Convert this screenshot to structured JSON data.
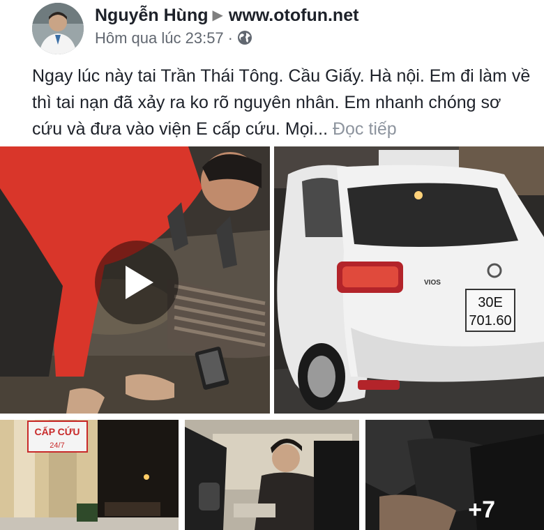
{
  "post": {
    "author": "Nguyễn Hùng",
    "group": "www.otofun.net",
    "timestamp": "Hôm qua lúc 23:57",
    "separator": "·",
    "text": "Ngay lúc này tai Trần Thái Tông. Cầu Giấy. Hà nội. Em đi làm về thì tai nạn đã xảy ra ko rõ nguyên nhân. Em nhanh chóng sơ cứu và đưa vào viện E cấp cứu. Mọi...",
    "see_more": "Đọc tiếp",
    "privacy_icon": "globe-icon"
  },
  "media": {
    "plate_line1": "30E",
    "plate_line2": "701.60",
    "car_badge": "VIOS",
    "sign_text": "CẤP CỨU",
    "sign_sub": "24/7",
    "more_count": "+7"
  },
  "colors": {
    "red_shirt": "#d9362a",
    "car_white": "#f2f2f2",
    "meta_gray": "#616770",
    "see_more_gray": "#8d949e"
  }
}
